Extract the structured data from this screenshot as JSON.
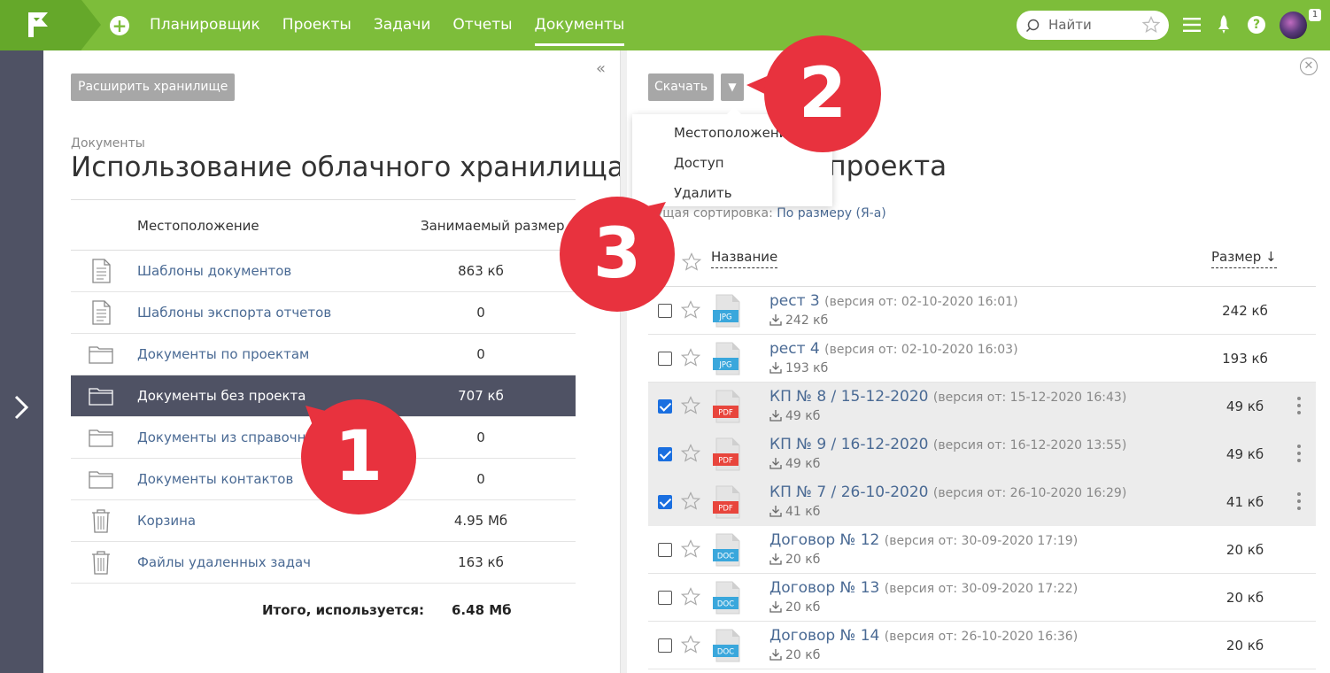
{
  "topbar": {
    "nav": [
      "Планировщик",
      "Проекты",
      "Задачи",
      "Отчеты",
      "Документы"
    ],
    "active_index": 4,
    "search_placeholder": "Найти",
    "notification_count": "1"
  },
  "left_panel": {
    "expand_button": "Расширить хранилище",
    "breadcrumb": "Документы",
    "title": "Использование облачного хранилища",
    "col_location": "Местоположение",
    "col_size": "Занимаемый размер",
    "rows": [
      {
        "icon": "document-icon",
        "name": "Шаблоны документов",
        "size": "863 кб"
      },
      {
        "icon": "document-icon",
        "name": "Шаблоны экспорта отчетов",
        "size": "0"
      },
      {
        "icon": "folder-icon",
        "name": "Документы по проектам",
        "size": "0"
      },
      {
        "icon": "folder-icon",
        "name": "Документы без проекта",
        "size": "707 кб",
        "selected": true
      },
      {
        "icon": "folder-icon",
        "name": "Документы из справочни",
        "size": "0"
      },
      {
        "icon": "folder-icon",
        "name": "Документы контактов",
        "size": "0"
      },
      {
        "icon": "trash-icon",
        "name": "Корзина",
        "size": "4.95 Мб"
      },
      {
        "icon": "trash-icon",
        "name": "Файлы удаленных задач",
        "size": "163 кб"
      }
    ],
    "total_label": "Итого, используется:",
    "total_value": "6.48 Мб"
  },
  "right_panel": {
    "download_button": "Скачать",
    "dropdown_items": [
      "Местоположение",
      "Доступ",
      "Удалить"
    ],
    "title": "ез проекта",
    "sort_label": "ущая сортировка:",
    "sort_value": "По размеру (Я-а)",
    "col_name": "Название",
    "col_size": "Размер ↓",
    "files": [
      {
        "type": "JPG",
        "color": "#3aa7dc",
        "name": "рест 3",
        "version": "(версия от: 02-10-2020 16:01)",
        "sub": "242 кб",
        "size": "242 кб",
        "checked": false
      },
      {
        "type": "JPG",
        "color": "#3aa7dc",
        "name": "рест 4",
        "version": "(версия от: 02-10-2020 16:03)",
        "sub": "193 кб",
        "size": "193 кб",
        "checked": false
      },
      {
        "type": "PDF",
        "color": "#e8453c",
        "name": "КП № 8 / 15-12-2020",
        "version": "(версия от: 15-12-2020 16:43)",
        "sub": "49 кб",
        "size": "49 кб",
        "checked": true
      },
      {
        "type": "PDF",
        "color": "#e8453c",
        "name": "КП № 9 / 16-12-2020",
        "version": "(версия от: 16-12-2020 13:55)",
        "sub": "49 кб",
        "size": "49 кб",
        "checked": true
      },
      {
        "type": "PDF",
        "color": "#e8453c",
        "name": "КП № 7 / 26-10-2020",
        "version": "(версия от: 26-10-2020 16:29)",
        "sub": "41 кб",
        "size": "41 кб",
        "checked": true
      },
      {
        "type": "DOC",
        "color": "#3aa7dc",
        "name": "Договор № 12",
        "version": "(версия от: 30-09-2020 17:19)",
        "sub": "20 кб",
        "size": "20 кб",
        "checked": false
      },
      {
        "type": "DOC",
        "color": "#3aa7dc",
        "name": "Договор № 13",
        "version": "(версия от: 30-09-2020 17:22)",
        "sub": "20 кб",
        "size": "20 кб",
        "checked": false
      },
      {
        "type": "DOC",
        "color": "#3aa7dc",
        "name": "Договор № 14",
        "version": "(версия от: 26-10-2020 16:36)",
        "sub": "20 кб",
        "size": "20 кб",
        "checked": false
      }
    ]
  },
  "markers": [
    "1",
    "2",
    "3"
  ],
  "colors": {
    "topbar": "#7dbd3a",
    "strip": "#4f5264",
    "marker": "#e8323e",
    "link": "#4a6a94"
  }
}
